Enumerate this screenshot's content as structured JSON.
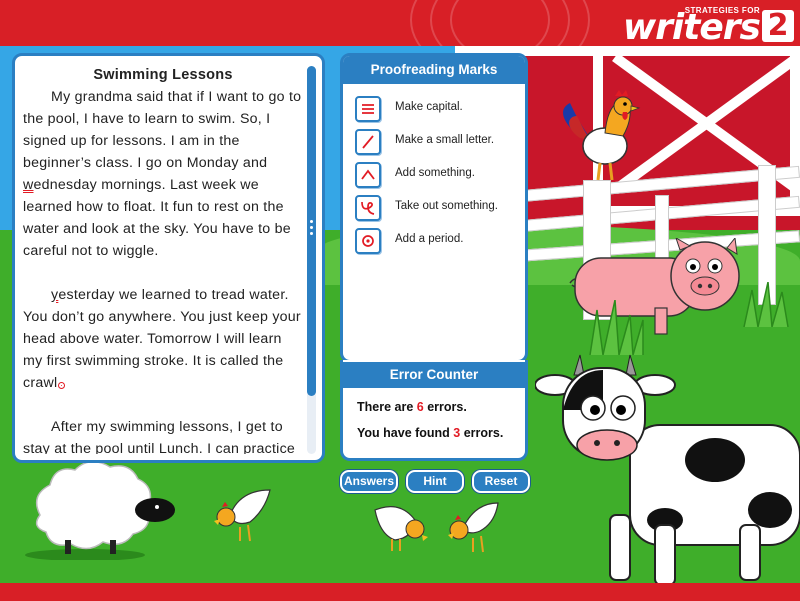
{
  "header": {
    "logo_small": "STRATEGIES FOR",
    "logo_word": "writers",
    "logo_num": "2"
  },
  "story": {
    "title": "Swimming Lessons",
    "p1_before": "My grandma said that if I want to go to the pool, I have to learn to swim. So, I signed up for lessons. I am in the beginner’s class. I go on Monday and ",
    "p1_marked": "w",
    "p1_after": "ednesday mornings. Last week we learned how to float. It fun to rest on the water and look at the sky. You have to be careful not to wiggle.",
    "p2_marked": "y",
    "p2_after": "esterday we learned to tread water. You don’t go anywhere. You just keep your head above water. Tomorrow I will learn my first swimming stroke. It is called the crawl",
    "p3": "After my swimming lessons, I get to stay at the pool until Lunch. I can practice"
  },
  "proofreading": {
    "title": "Proofreading Marks",
    "marks": [
      {
        "icon": "capital-mark-icon",
        "label": "Make capital."
      },
      {
        "icon": "slash-mark-icon",
        "label": "Make a small letter."
      },
      {
        "icon": "caret-mark-icon",
        "label": "Add something."
      },
      {
        "icon": "delete-mark-icon",
        "label": "Take out something."
      },
      {
        "icon": "period-mark-icon",
        "label": "Add a period."
      }
    ]
  },
  "counter": {
    "title": "Error Counter",
    "line1_prefix": "There are ",
    "total_errors": "6",
    "line1_suffix": " errors.",
    "line2_prefix": "You have found ",
    "found_errors": "3",
    "line2_suffix": " errors."
  },
  "buttons": {
    "answers": "Answers",
    "hint": "Hint",
    "reset": "Reset"
  },
  "colors": {
    "accent_blue": "#2b7fc2",
    "header_red": "#d81f26",
    "mark_red": "#e21b24",
    "grass": "#3fae2a"
  }
}
